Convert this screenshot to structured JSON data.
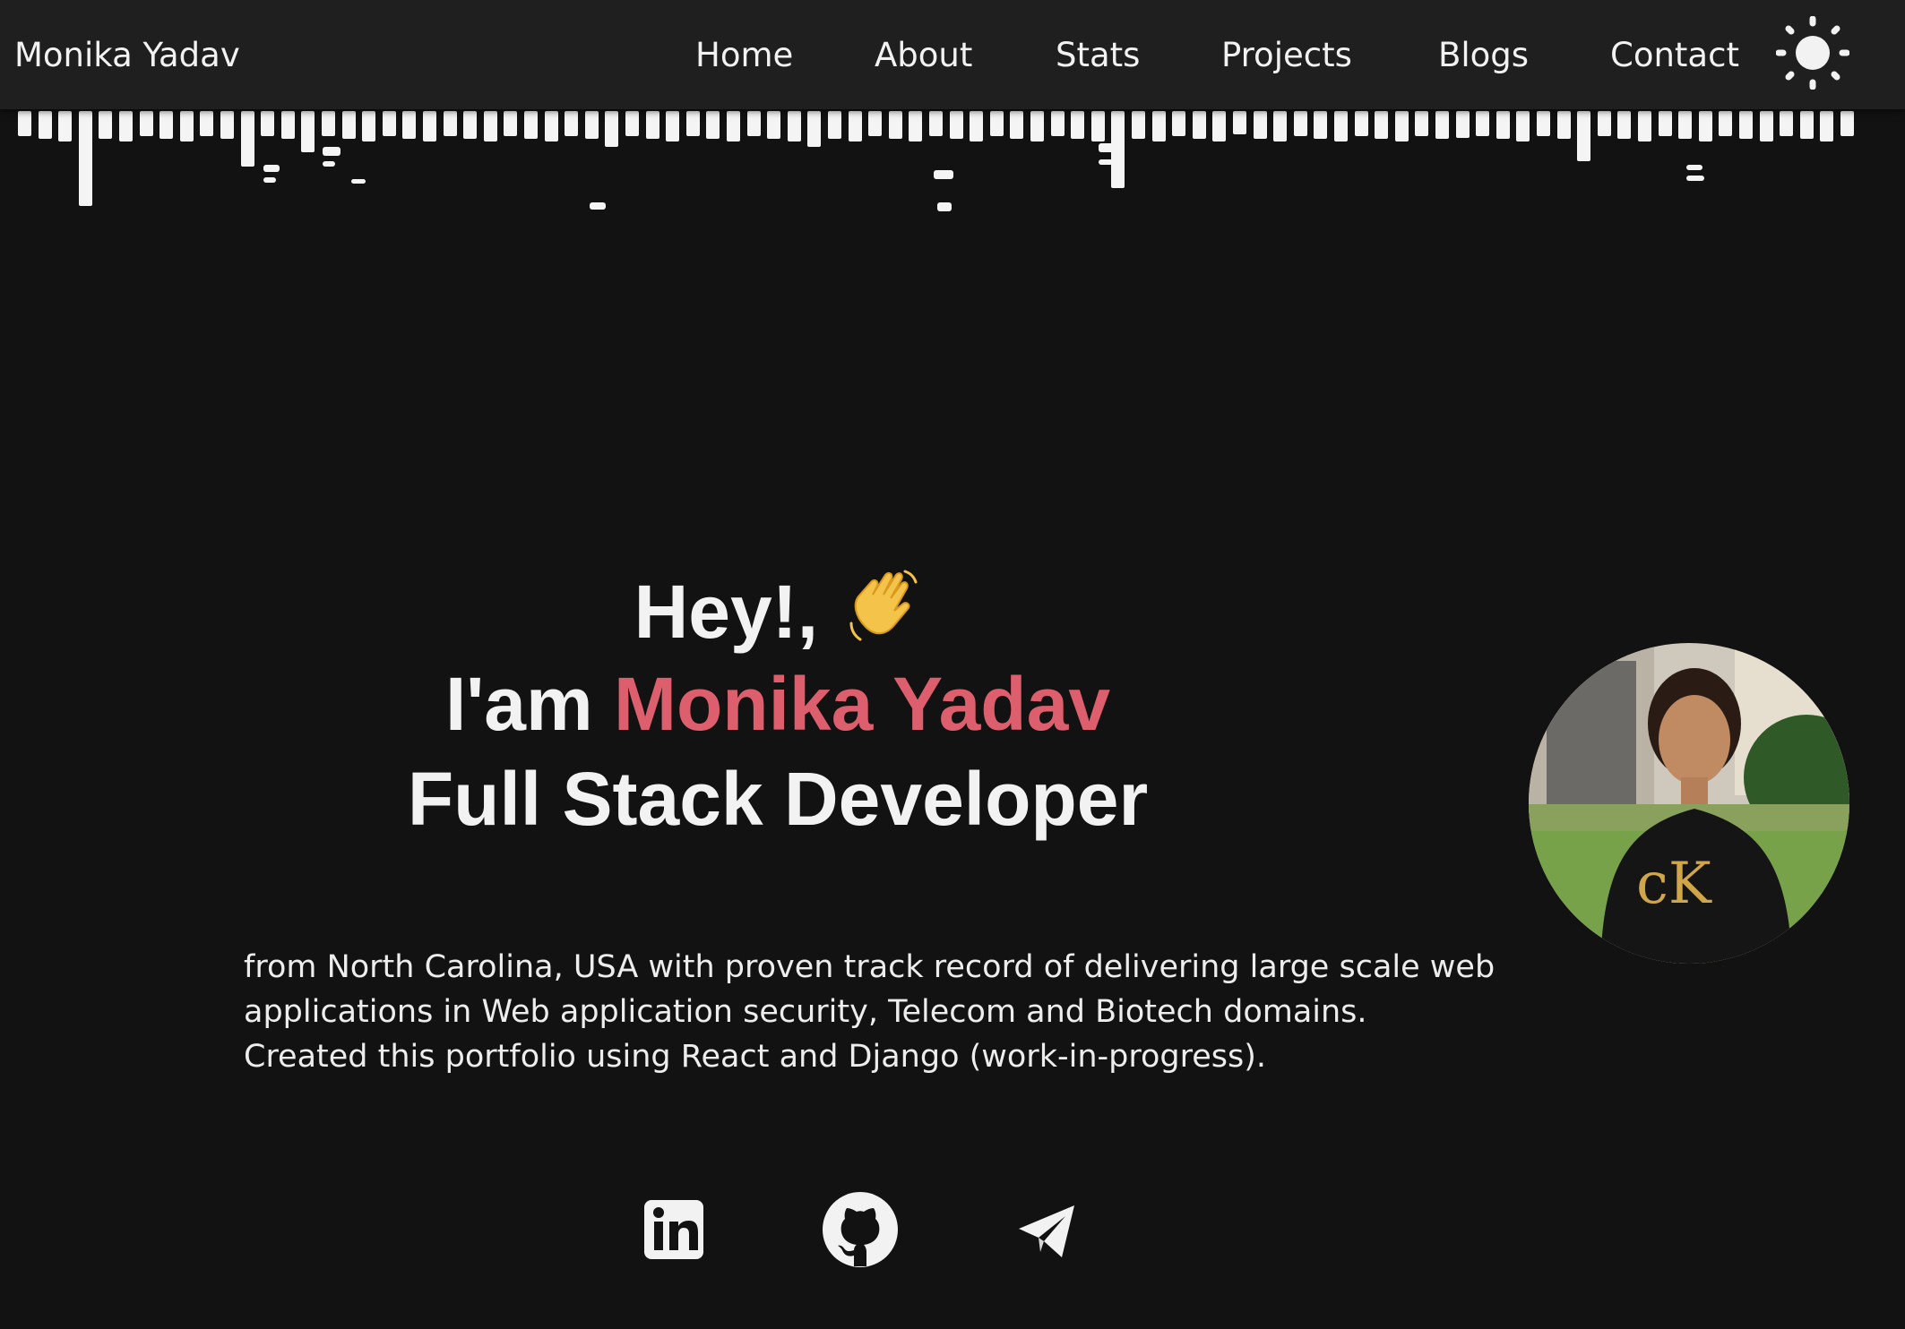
{
  "header": {
    "brand": "Monika Yadav",
    "nav": [
      "Home",
      "About",
      "Stats",
      "Projects",
      "Blogs",
      "Contact"
    ],
    "theme_icon": "sun-icon"
  },
  "hero": {
    "greeting": "Hey!,",
    "greeting_icon": "waving-hand-icon",
    "intro_prefix": "I'am ",
    "name": "Monika Yadav",
    "role": "Full Stack Developer",
    "description": "from North Carolina, USA with proven track record of delivering large scale web applications in Web application security, Telecom and Biotech domains. Created this portfolio using React and Django (work-in-progress).",
    "accent_color": "#dd5f6d"
  },
  "social": [
    {
      "icon": "linkedin-icon"
    },
    {
      "icon": "github-icon"
    },
    {
      "icon": "telegram-icon"
    }
  ],
  "colors": {
    "background": "#121212",
    "navbar": "#1f1f1f",
    "text": "#f2f2f2",
    "accent": "#dd5f6d"
  }
}
